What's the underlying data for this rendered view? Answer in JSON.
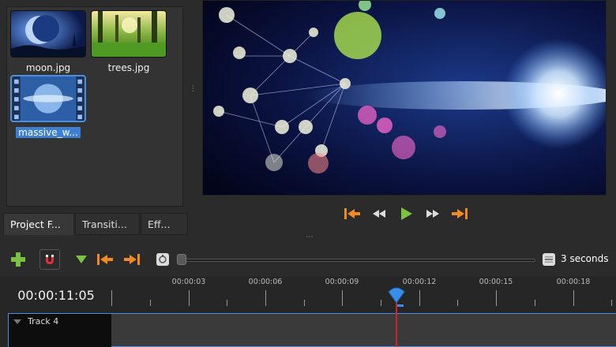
{
  "project_files": {
    "items": [
      {
        "name": "moon.jpg",
        "icon": "moon-thumbnail"
      },
      {
        "name": "trees.jpg",
        "icon": "trees-thumbnail"
      },
      {
        "name": "massive_w...",
        "icon": "video-thumbnail",
        "selected": true
      }
    ]
  },
  "tabs": [
    {
      "label": "Project F...",
      "active": true
    },
    {
      "label": "Transiti..."
    },
    {
      "label": "Eff..."
    }
  ],
  "transport": {
    "buttons": [
      "jump-to-start-icon",
      "rewind-icon",
      "play-icon",
      "fast-forward-icon",
      "jump-to-end-icon"
    ]
  },
  "toolbar": {
    "tools": [
      "add-track-icon",
      "snapping-magnet-icon",
      "add-marker-icon",
      "previous-marker-icon",
      "next-marker-icon",
      "zoom-center-icon"
    ],
    "zoom_label": "3 seconds",
    "zoom_level": 0.0
  },
  "timeline": {
    "timecode": "00:00:11:05",
    "ticks": [
      "00:00:03",
      "00:00:06",
      "00:00:09",
      "00:00:12",
      "00:00:15",
      "00:00:18"
    ],
    "tracks": [
      {
        "name": "Track 4"
      }
    ]
  },
  "colors": {
    "accent": "#4a90e2",
    "orange": "#f08a24",
    "play_green": "#7cc242",
    "playhead": "#d0222b"
  }
}
